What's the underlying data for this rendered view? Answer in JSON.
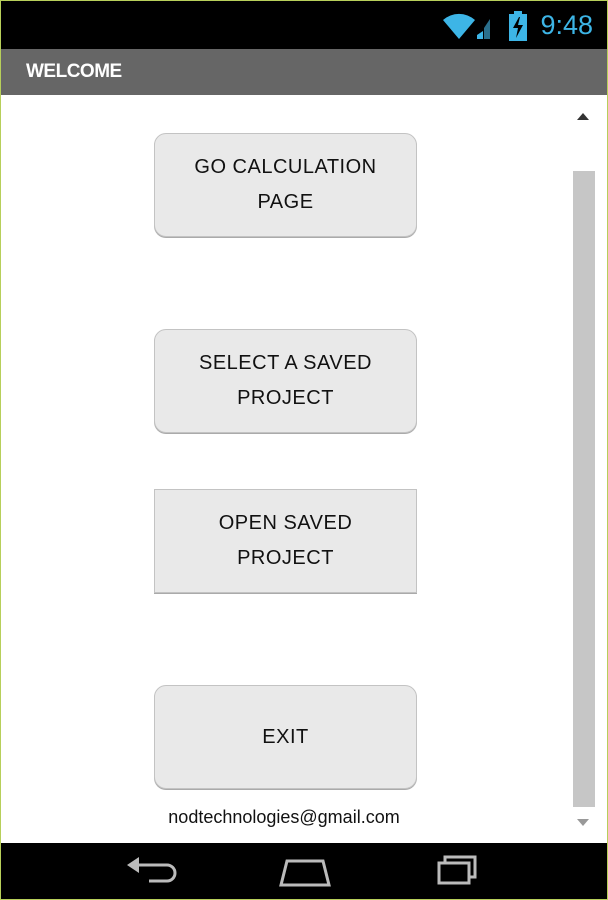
{
  "status_bar": {
    "time": "9:48",
    "icons": [
      "wifi-icon",
      "signal-icon",
      "battery-charging-icon"
    ],
    "accent_color": "#3db5e6"
  },
  "title_bar": {
    "title": "WELCOME"
  },
  "buttons": {
    "go_calculation": "GO CALCULATION PAGE",
    "select_saved": "SELECT A SAVED PROJECT",
    "open_saved": "OPEN SAVED PROJECT",
    "exit": "EXIT"
  },
  "footer": {
    "email": "nodtechnologies@gmail.com"
  },
  "nav_bar": {
    "icons": [
      "back-icon",
      "home-icon",
      "recent-apps-icon"
    ]
  }
}
